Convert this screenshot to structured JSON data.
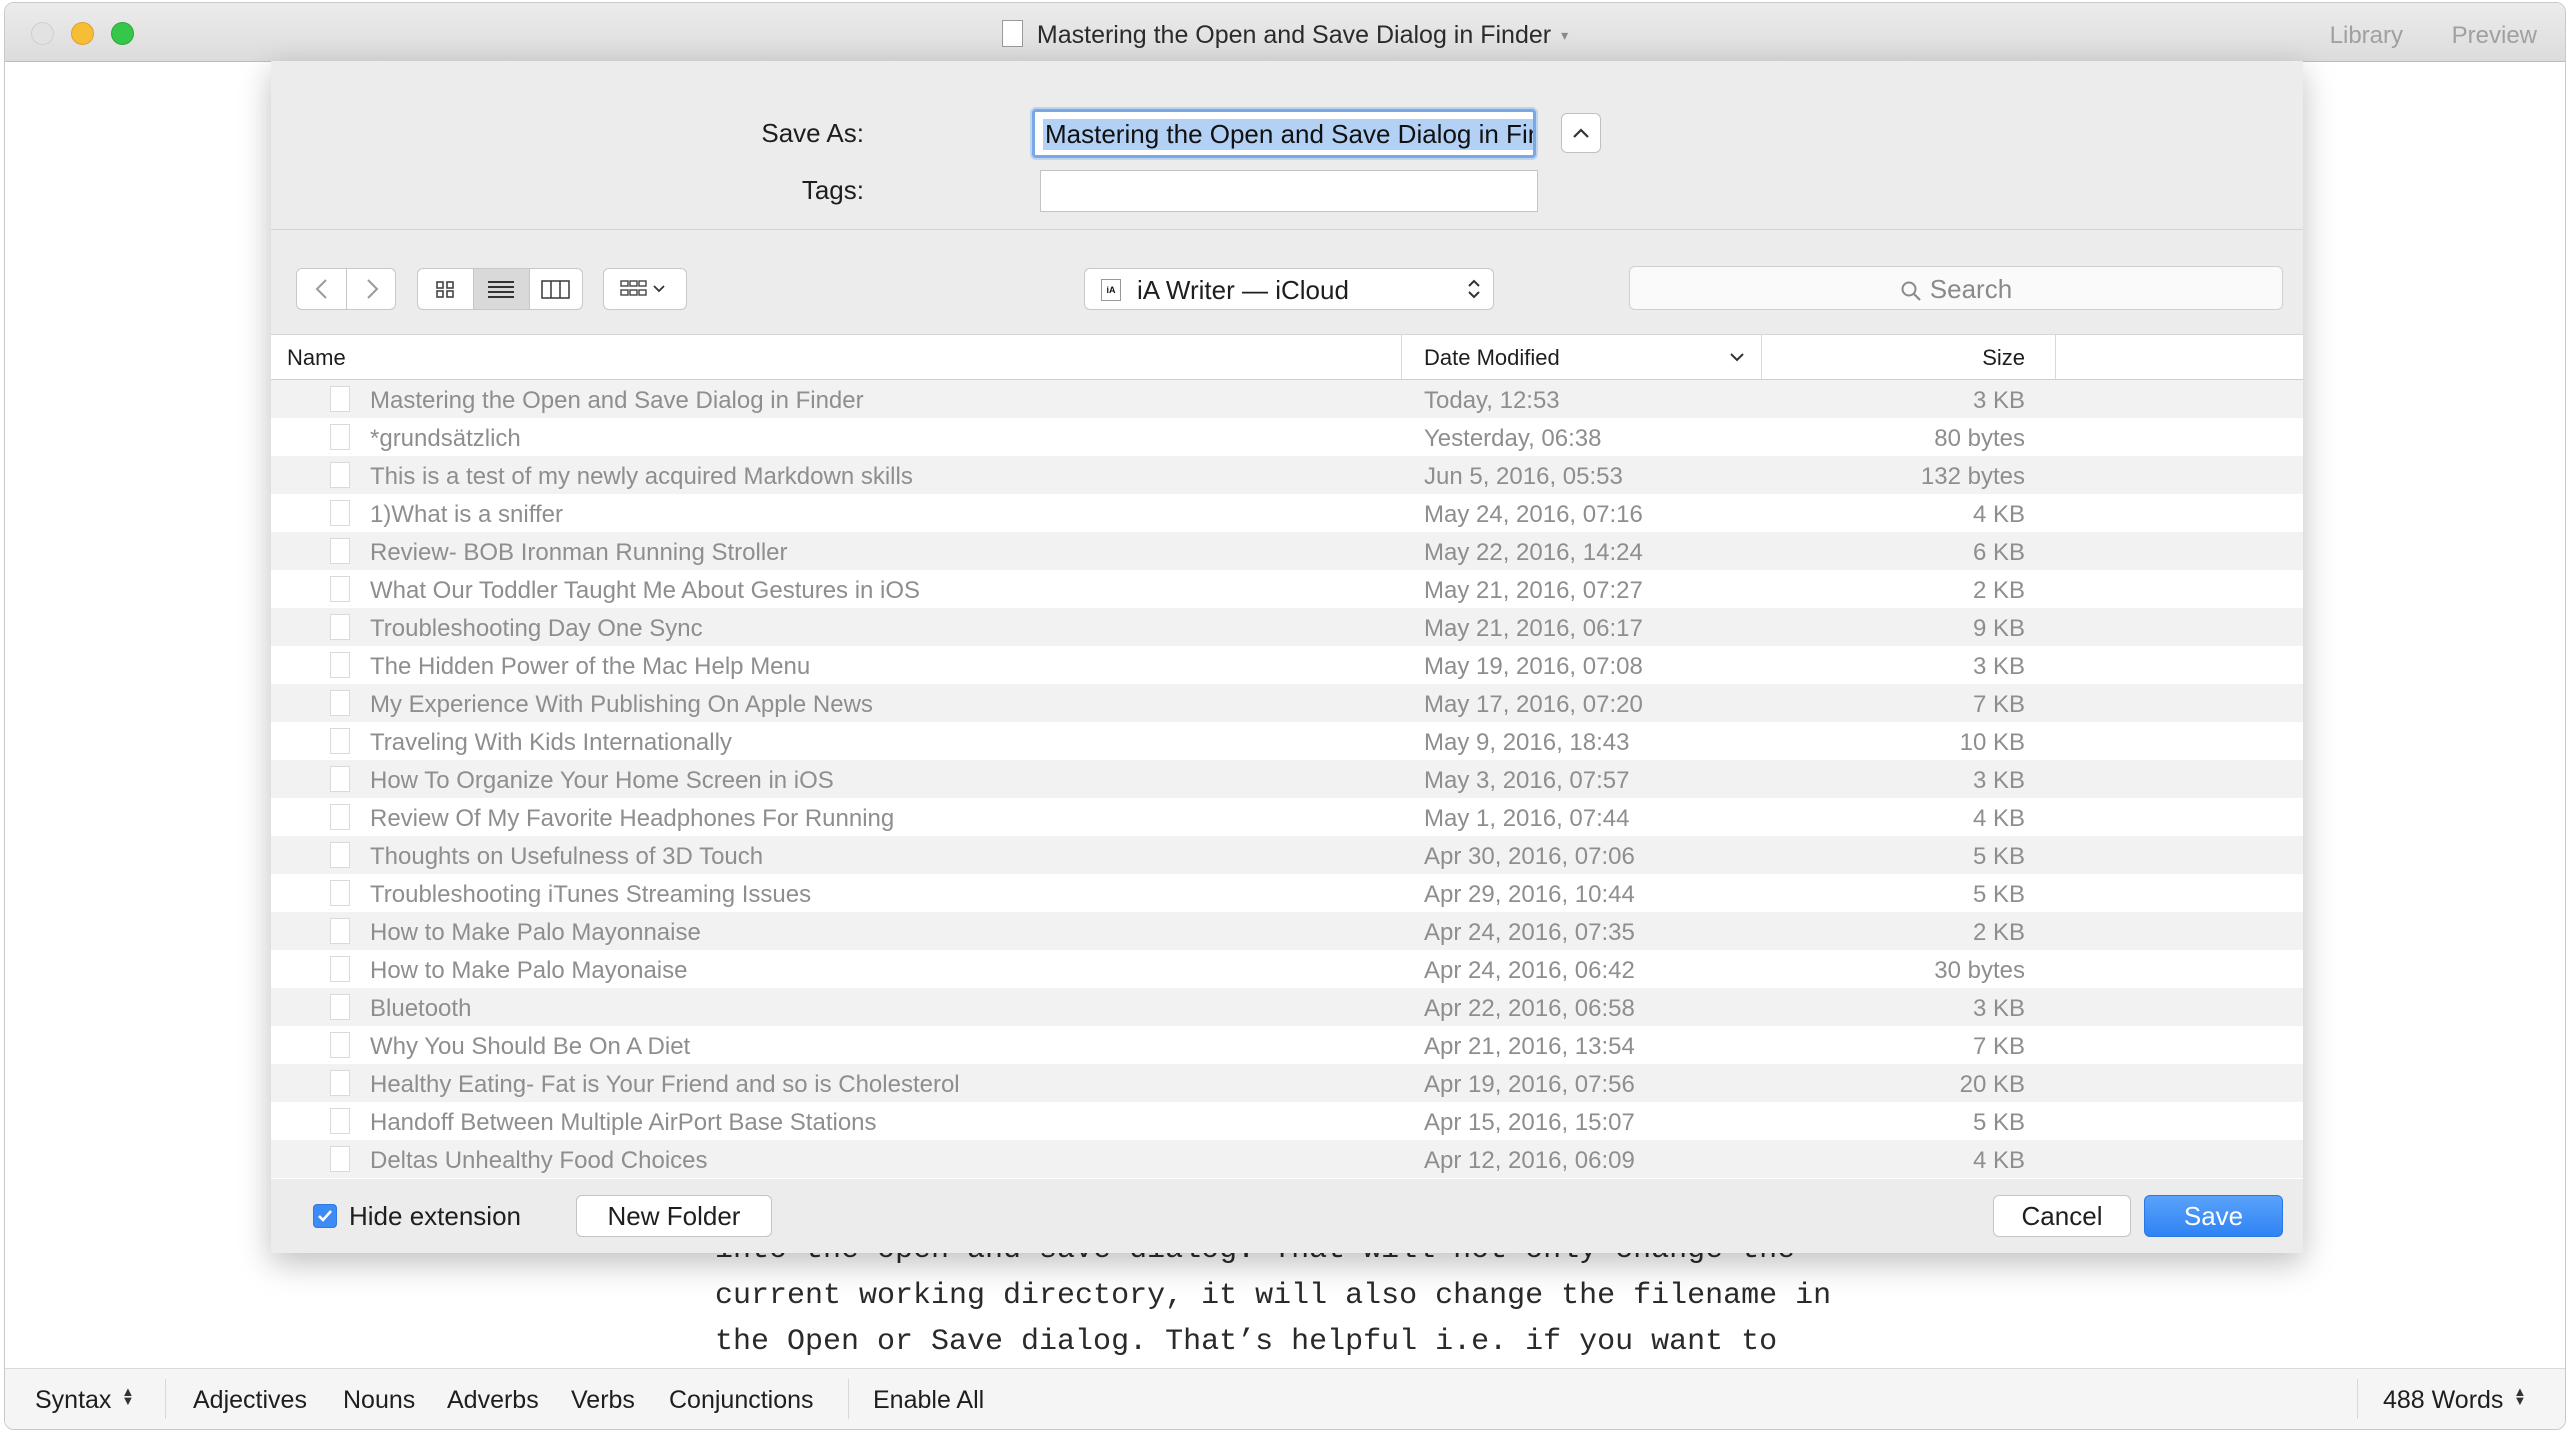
{
  "window": {
    "title": "Mastering the Open and Save Dialog in Finder",
    "library_label": "Library",
    "preview_label": "Preview"
  },
  "editor": {
    "lines": [
      "into the open and save dialog. That will not only change the",
      "current working directory, it will also change the filename in",
      "the Open or Save dialog. That’s helpful i.e. if you want to"
    ]
  },
  "status_bar": {
    "syntax_label": "Syntax",
    "items": [
      "Adjectives",
      "Nouns",
      "Adverbs",
      "Verbs",
      "Conjunctions"
    ],
    "enable_all_label": "Enable All",
    "word_count": "488 Words"
  },
  "dialog": {
    "save_as_label": "Save As:",
    "save_as_value": "Mastering the Open and Save Dialog in Finder",
    "tags_label": "Tags:",
    "tags_value": "",
    "location": "iA Writer — iCloud",
    "location_badge": "iA",
    "search_placeholder": "Search",
    "columns": {
      "name": "Name",
      "date": "Date Modified",
      "size": "Size"
    },
    "files": [
      {
        "name": "Mastering the Open and Save Dialog in Finder",
        "date": "Today, 12:53",
        "size": "3 KB"
      },
      {
        "name": "*grundsätzlich",
        "date": "Yesterday, 06:38",
        "size": "80 bytes"
      },
      {
        "name": "This is a test of my newly acquired Markdown skills",
        "date": "Jun 5, 2016, 05:53",
        "size": "132 bytes"
      },
      {
        "name": "1)What is a sniffer",
        "date": "May 24, 2016, 07:16",
        "size": "4 KB"
      },
      {
        "name": "Review- BOB Ironman Running Stroller",
        "date": "May 22, 2016, 14:24",
        "size": "6 KB"
      },
      {
        "name": "What Our Toddler Taught Me About Gestures in iOS",
        "date": "May 21, 2016, 07:27",
        "size": "2 KB"
      },
      {
        "name": "Troubleshooting Day One Sync",
        "date": "May 21, 2016, 06:17",
        "size": "9 KB"
      },
      {
        "name": "The Hidden Power of the Mac Help Menu",
        "date": "May 19, 2016, 07:08",
        "size": "3 KB"
      },
      {
        "name": "My Experience With Publishing On Apple News",
        "date": "May 17, 2016, 07:20",
        "size": "7 KB"
      },
      {
        "name": "Traveling With Kids Internationally",
        "date": "May 9, 2016, 18:43",
        "size": "10 KB"
      },
      {
        "name": "How To Organize Your Home Screen in iOS",
        "date": "May 3, 2016, 07:57",
        "size": "3 KB"
      },
      {
        "name": "Review Of My Favorite Headphones For Running",
        "date": "May 1, 2016, 07:44",
        "size": "4 KB"
      },
      {
        "name": "Thoughts on Usefulness of 3D Touch",
        "date": "Apr 30, 2016, 07:06",
        "size": "5 KB"
      },
      {
        "name": "Troubleshooting iTunes Streaming Issues",
        "date": "Apr 29, 2016, 10:44",
        "size": "5 KB"
      },
      {
        "name": "How to Make Palo Mayonnaise",
        "date": "Apr 24, 2016, 07:35",
        "size": "2 KB"
      },
      {
        "name": "How to Make Palo Mayonaise",
        "date": "Apr 24, 2016, 06:42",
        "size": "30 bytes"
      },
      {
        "name": "Bluetooth",
        "date": "Apr 22, 2016, 06:58",
        "size": "3 KB"
      },
      {
        "name": "Why You Should Be On A Diet",
        "date": "Apr 21, 2016, 13:54",
        "size": "7 KB"
      },
      {
        "name": "Healthy Eating- Fat is Your Friend and so is Cholesterol",
        "date": "Apr 19, 2016, 07:56",
        "size": "20 KB"
      },
      {
        "name": "Handoff Between Multiple AirPort Base Stations",
        "date": "Apr 15, 2016, 15:07",
        "size": "5 KB"
      },
      {
        "name": "Deltas Unhealthy Food Choices",
        "date": "Apr 12, 2016, 06:09",
        "size": "4 KB"
      }
    ],
    "hide_extension_label": "Hide extension",
    "hide_extension_checked": true,
    "new_folder_label": "New Folder",
    "cancel_label": "Cancel",
    "save_label": "Save"
  },
  "colors": {
    "accent": "#2f83f4",
    "selection": "#b3d1f5"
  },
  "icons": {
    "close": "close-icon",
    "minimize": "minimize-icon",
    "zoom": "zoom-icon",
    "document": "document-icon",
    "back": "chevron-left-icon",
    "forward": "chevron-right-icon",
    "icon_view": "icon-view-icon",
    "list_view": "list-view-icon",
    "column_view": "column-view-icon",
    "arrange": "arrange-icon",
    "search": "search-icon",
    "expand": "chevron-up-icon",
    "file": "file-icon",
    "checkbox": "checkmark-icon"
  }
}
